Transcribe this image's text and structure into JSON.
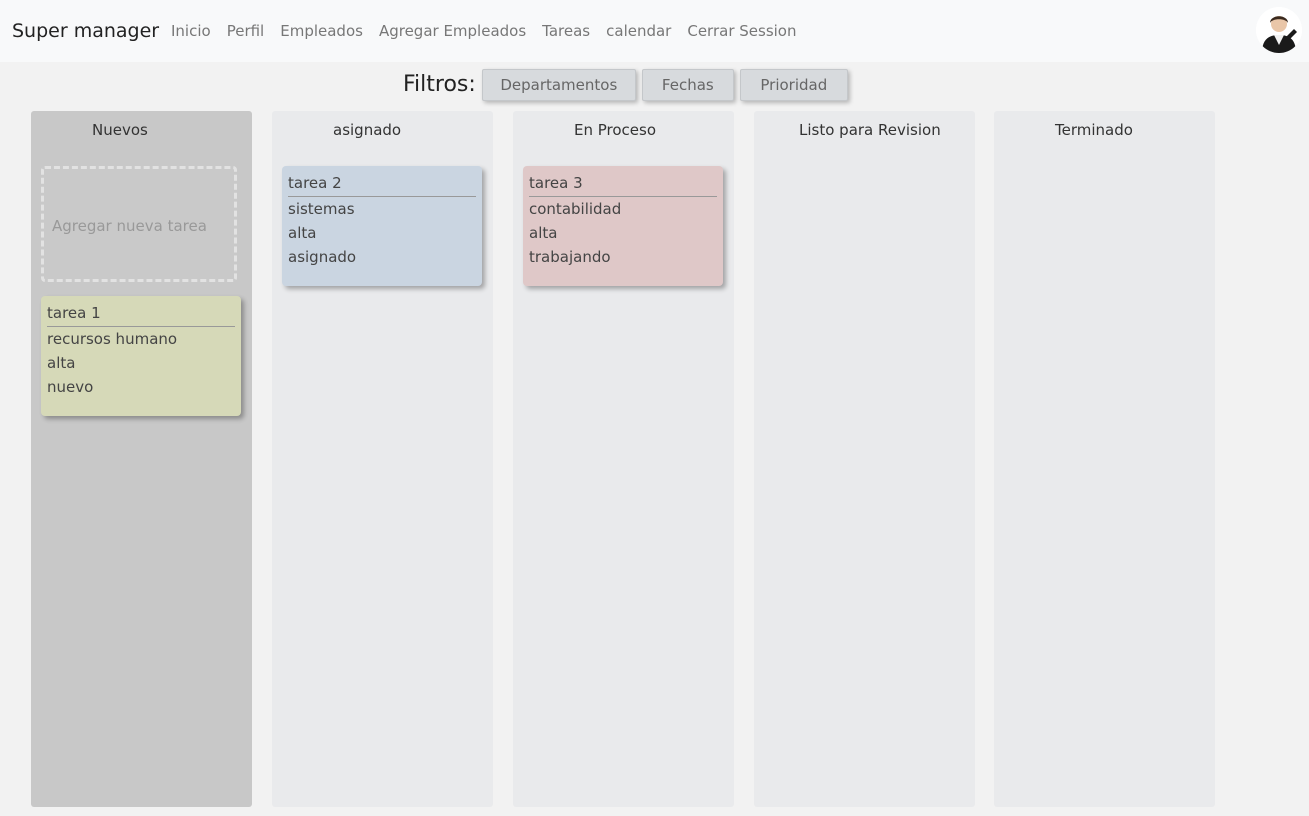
{
  "navbar": {
    "brand": "Super manager",
    "links": [
      "Inicio",
      "Perfil",
      "Empleados",
      "Agregar Empleados",
      "Tareas",
      "calendar",
      "Cerrar Session"
    ]
  },
  "filters": {
    "label": "Filtros:",
    "buttons": [
      "Departamentos",
      "Fechas",
      "Prioridad"
    ]
  },
  "board": {
    "columns": [
      {
        "title": "Nuevos"
      },
      {
        "title": "asignado"
      },
      {
        "title": "En Proceso"
      },
      {
        "title": "Listo para Revision"
      },
      {
        "title": "Terminado"
      }
    ],
    "add_task_label": "Agregar nueva tarea",
    "tasks": [
      {
        "title": "tarea 1",
        "department": "recursos humano",
        "priority": "alta",
        "status": "nuevo",
        "color": "#d6d9b8"
      },
      {
        "title": "tarea 2",
        "department": "sistemas",
        "priority": "alta",
        "status": "asignado",
        "color": "#cad5e1"
      },
      {
        "title": "tarea 3",
        "department": "contabilidad",
        "priority": "alta",
        "status": "trabajando",
        "color": "#dfc8c8"
      }
    ]
  }
}
